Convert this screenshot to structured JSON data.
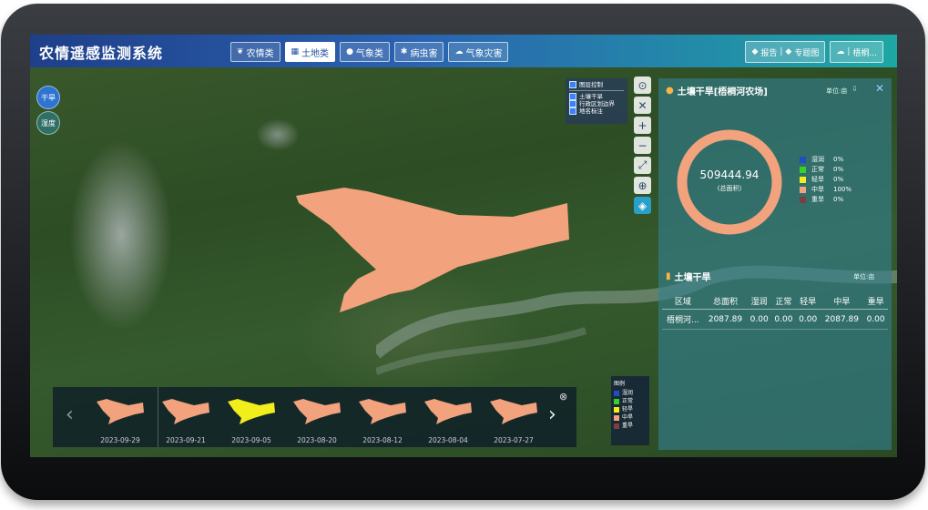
{
  "app_title": "农情遥感监测系统",
  "nav_tabs": [
    {
      "label": "农情类",
      "icon": "leaf-icon"
    },
    {
      "label": "土地类",
      "icon": "grid-icon"
    },
    {
      "label": "气象类",
      "icon": "droplet-icon"
    },
    {
      "label": "病虫害",
      "icon": "bug-icon"
    },
    {
      "label": "气象灾害",
      "icon": "cloud-icon"
    }
  ],
  "active_tab": "土地类",
  "header_buttons": {
    "report": "报告",
    "topic_map": "专题图",
    "user": "梧桐..."
  },
  "side_buttons": {
    "drought": "干旱",
    "humidity": "湿度"
  },
  "layer_control": {
    "title": "图层控制",
    "items": [
      "土壤干旱",
      "行政区划边界",
      "地名标注"
    ]
  },
  "panel": {
    "title": "土壤干旱[梧桐河农场]",
    "unit_label": "单位:亩",
    "total_area": "509444.94",
    "total_area_caption": "(总面积)",
    "legend": [
      {
        "name": "湿润",
        "pct": "0%",
        "color": "#1f4fbf"
      },
      {
        "name": "正常",
        "pct": "0%",
        "color": "#35d12b"
      },
      {
        "name": "轻旱",
        "pct": "0%",
        "color": "#f2ee1c"
      },
      {
        "name": "中旱",
        "pct": "100%",
        "color": "#f2a27d"
      },
      {
        "name": "重旱",
        "pct": "0%",
        "color": "#7a4040"
      }
    ]
  },
  "table_section": {
    "title": "土壤干旱",
    "unit_label": "单位:亩",
    "headers": [
      "区域",
      "总面积",
      "湿润",
      "正常",
      "轻旱",
      "中旱",
      "重旱"
    ],
    "rows": [
      [
        "梧桐河...",
        "2087.89",
        "0.00",
        "0.00",
        "0.00",
        "2087.89",
        "0.00"
      ]
    ]
  },
  "timeline": {
    "dates": [
      "2023-09-29",
      "2023-09-21",
      "2023-09-05",
      "2023-08-20",
      "2023-08-12",
      "2023-08-04",
      "2023-07-27"
    ],
    "colors": [
      "#f2a27d",
      "#f2a27d",
      "#f2ee1c",
      "#f2a27d",
      "#f2a27d",
      "#f2a27d",
      "#f2a27d"
    ]
  },
  "map_legend": {
    "title": "图例",
    "items": [
      {
        "name": "湿润",
        "color": "#1f4fbf"
      },
      {
        "name": "正常",
        "color": "#35d12b"
      },
      {
        "name": "轻旱",
        "color": "#f2ee1c"
      },
      {
        "name": "中旱",
        "color": "#f2a27d"
      },
      {
        "name": "重旱",
        "color": "#7a4040"
      }
    ]
  }
}
